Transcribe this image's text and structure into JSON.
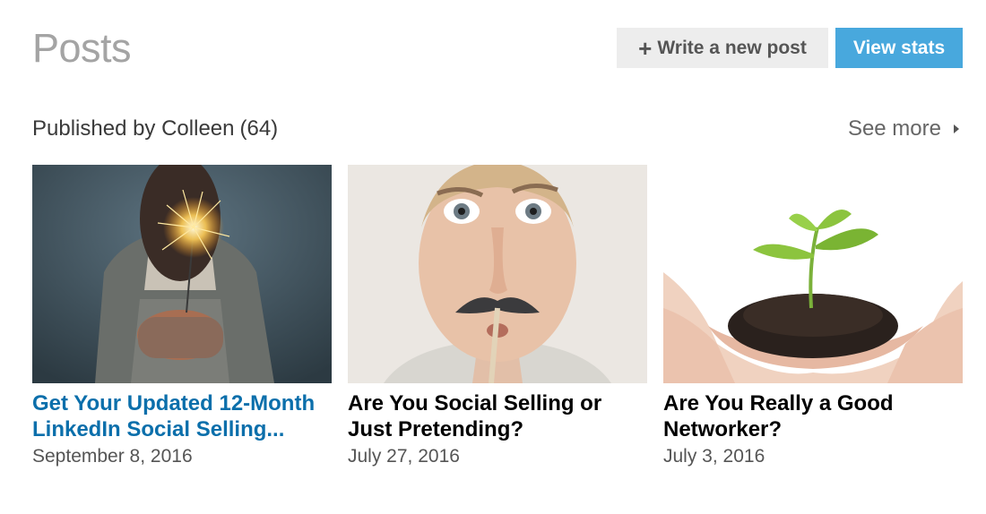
{
  "header": {
    "title": "Posts",
    "write_button": {
      "icon": "plus-icon",
      "label": "Write a new post"
    },
    "stats_button": {
      "label": "View stats"
    }
  },
  "section": {
    "title": "Published by Colleen",
    "count": "(64)",
    "see_more": "See more"
  },
  "posts": [
    {
      "title": "Get Your Updated 12-Month LinkedIn Social Selling...",
      "date": "September 8, 2016",
      "highlighted": true
    },
    {
      "title": "Are You Social Selling or Just Pretending?",
      "date": "July 27, 2016",
      "highlighted": false
    },
    {
      "title": "Are You Really a Good Networker?",
      "date": "July 3, 2016",
      "highlighted": false
    }
  ],
  "colors": {
    "link": "#0b6fab",
    "primary_button": "#48a8dd",
    "secondary_button": "#ededed"
  }
}
